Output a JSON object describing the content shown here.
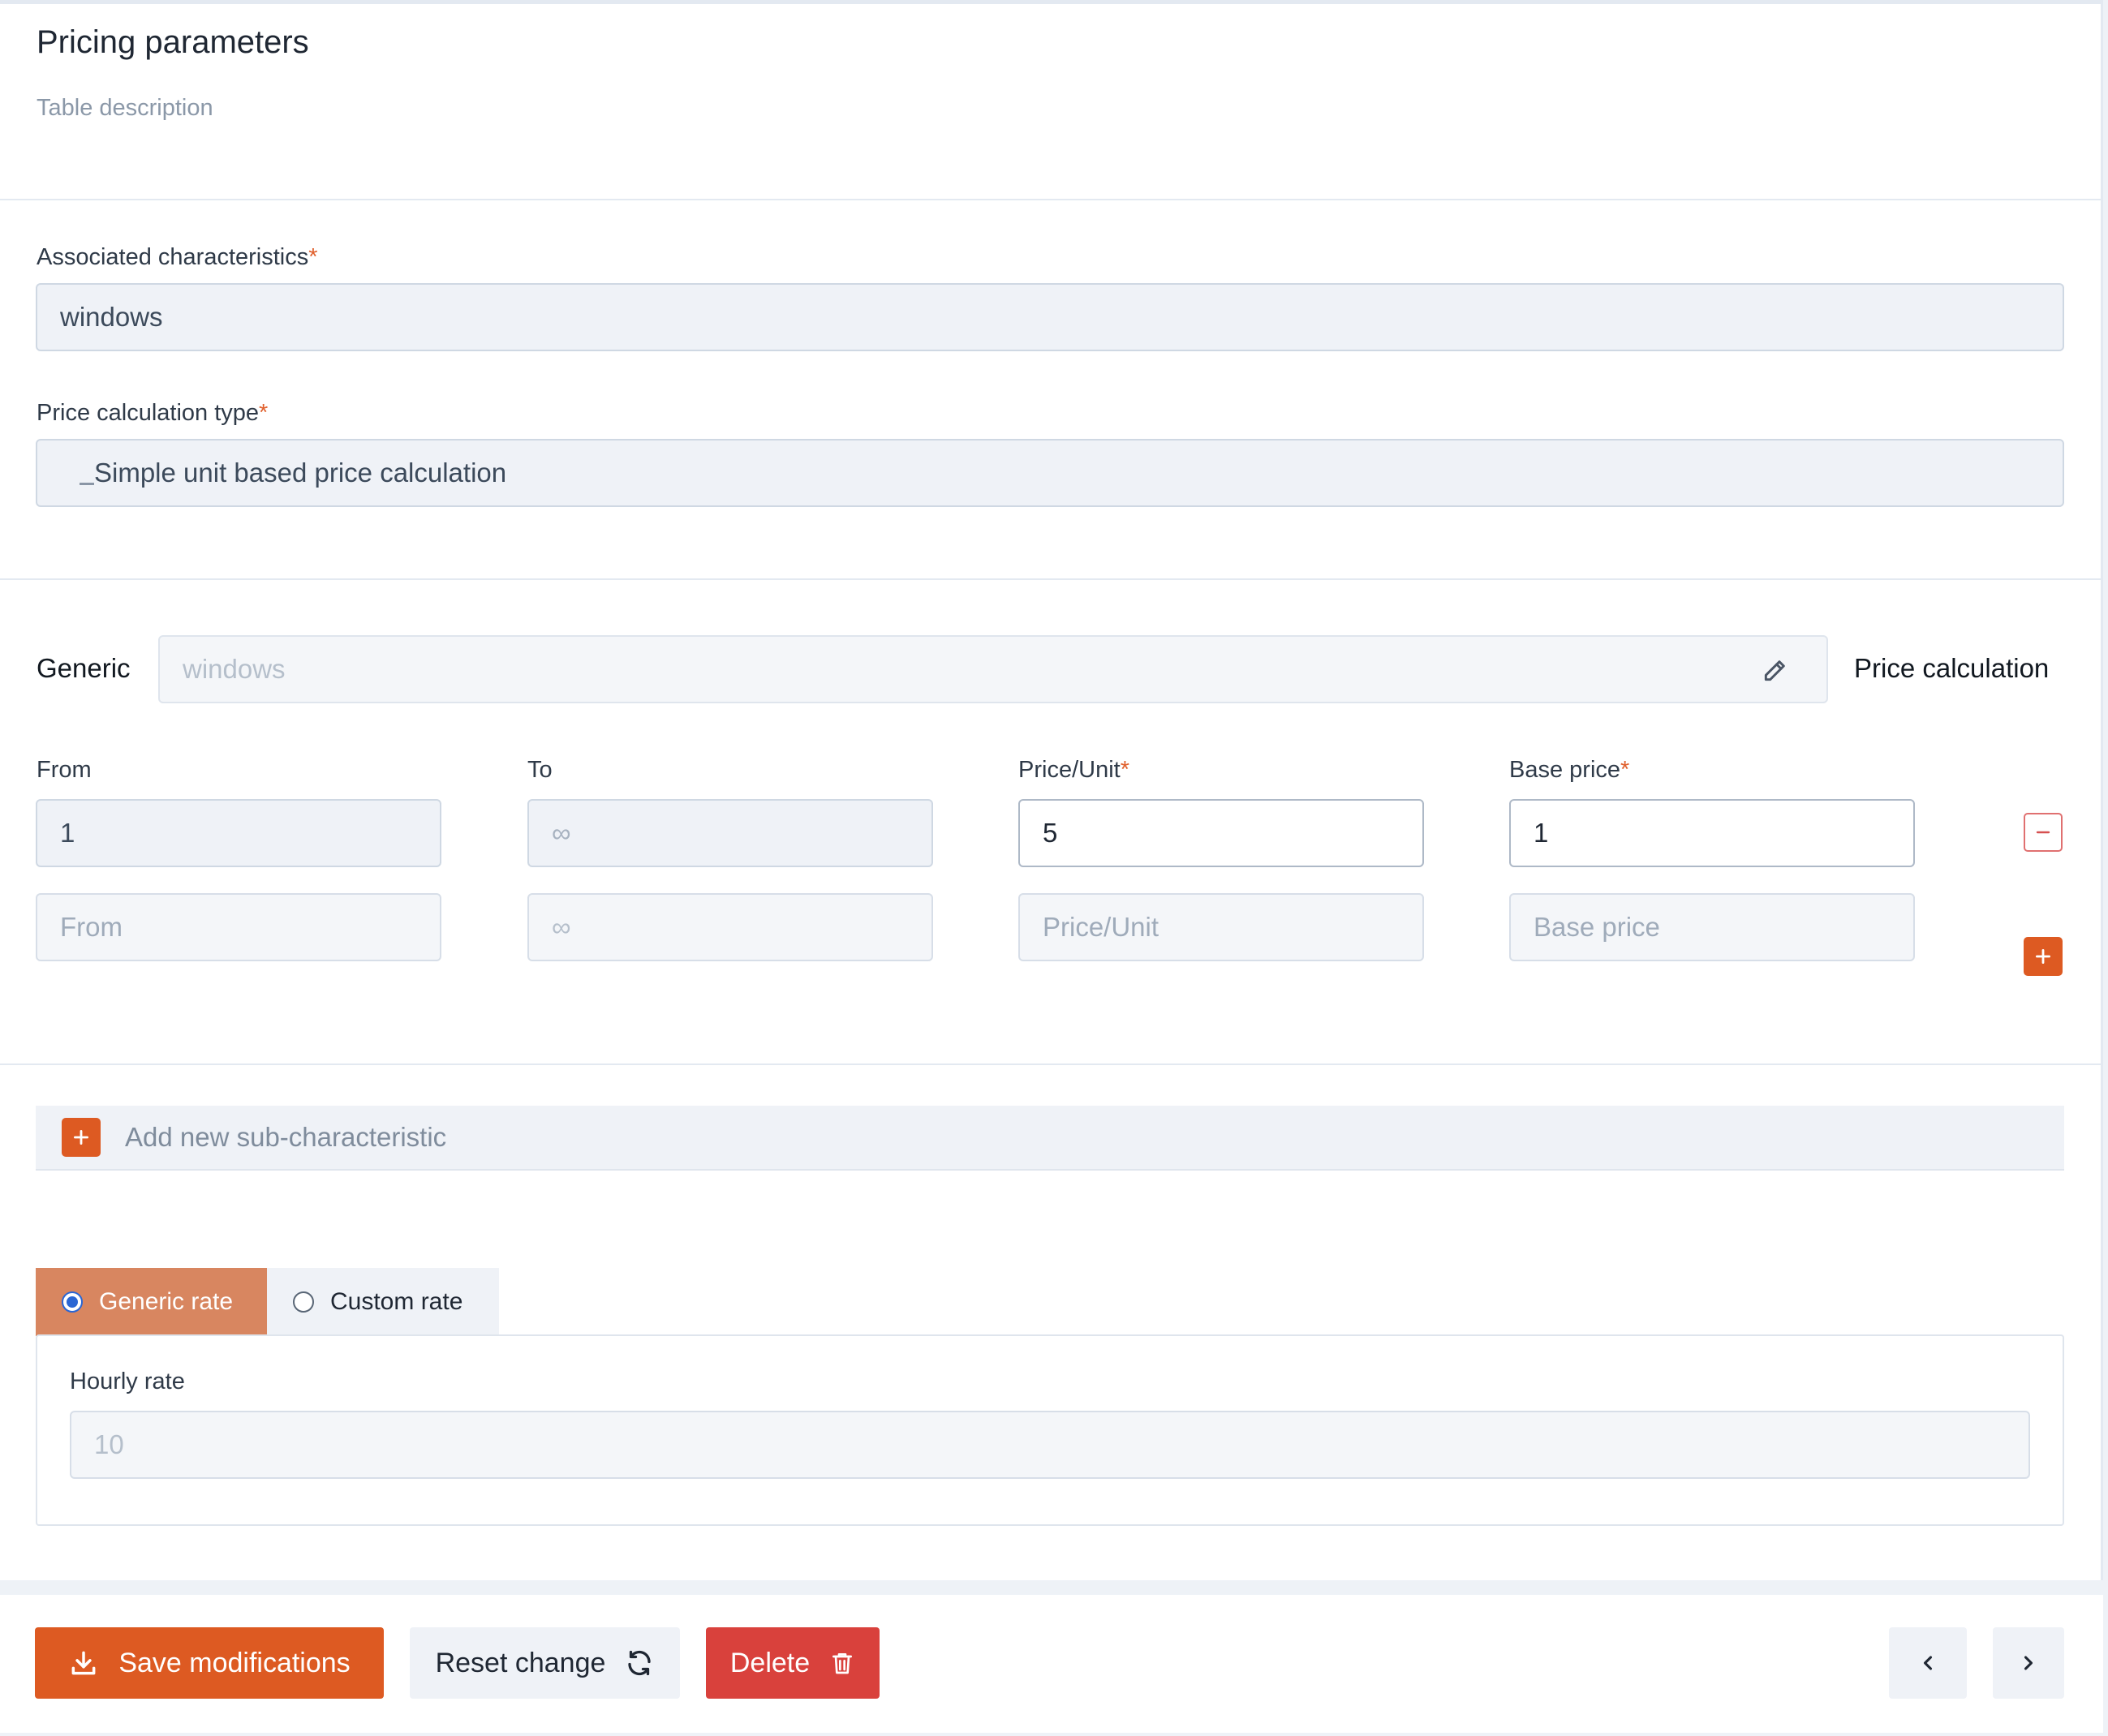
{
  "header": {
    "title": "Pricing parameters",
    "description": "Table description"
  },
  "associated": {
    "label": "Associated characteristics",
    "required_mark": "*",
    "value": "windows"
  },
  "calc_type": {
    "label": "Price calculation type",
    "required_mark": "*",
    "value": "Simple unit based price calculation"
  },
  "generic": {
    "label": "Generic",
    "value": "windows",
    "right_label": "Price calculation"
  },
  "columns": {
    "from": "From",
    "to": "To",
    "price_unit": "Price/Unit",
    "base_price": "Base price",
    "required_mark": "*"
  },
  "rows": [
    {
      "from": "1",
      "to": "∞",
      "price_unit": "5",
      "base_price": "1"
    }
  ],
  "new_row": {
    "from_placeholder": "From",
    "to_value": "∞",
    "price_unit_placeholder": "Price/Unit",
    "base_price_placeholder": "Base price"
  },
  "sub_characteristic": {
    "label": "Add new sub-characteristic"
  },
  "rate_tabs": [
    {
      "label": "Generic rate",
      "selected": true
    },
    {
      "label": "Custom rate",
      "selected": false
    }
  ],
  "hourly_rate": {
    "label": "Hourly rate",
    "value": "10"
  },
  "footer": {
    "save_label": "Save modifications",
    "reset_label": "Reset change",
    "delete_label": "Delete"
  },
  "icons": {
    "edit": "pencil-icon",
    "remove_row": "minus-icon",
    "add_row": "plus-icon",
    "save": "download-icon",
    "reset": "refresh-icon",
    "delete": "trash-icon",
    "prev": "chevron-left-icon",
    "next": "chevron-right-icon"
  },
  "colors": {
    "accent": "#dd5a22",
    "danger": "#d9413c",
    "active_tab": "#d88660",
    "required": "#e0602d"
  }
}
